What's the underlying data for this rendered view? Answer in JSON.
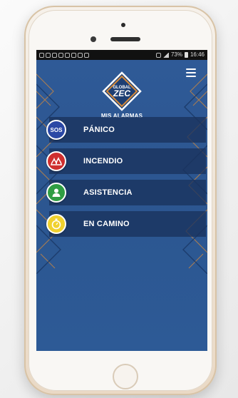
{
  "status_bar": {
    "battery_percent": "73%",
    "time": "16:46"
  },
  "app": {
    "logo_text_top": "GLOBAL",
    "logo_text_main": "ZEC",
    "section_title": "MIS ALARMAS"
  },
  "alarms": [
    {
      "label": "PÁNICO",
      "icon": "sos-icon",
      "color": "#2b48a5",
      "icon_text": "SOS"
    },
    {
      "label": "INCENDIO",
      "icon": "fire-icon",
      "color": "#cf2f2f"
    },
    {
      "label": "ASISTENCIA",
      "icon": "person-icon",
      "color": "#2f9d43"
    },
    {
      "label": "EN CAMINO",
      "icon": "stopwatch-icon",
      "color": "#f0d12e"
    }
  ],
  "colors": {
    "screen_bg": "#2e5792",
    "accent_orange": "#d48a3b"
  }
}
